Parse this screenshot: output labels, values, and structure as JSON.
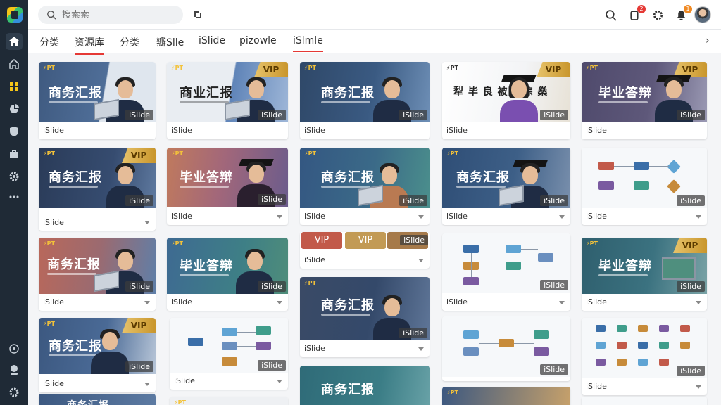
{
  "search": {
    "placeholder": "搜索索"
  },
  "tabs": [
    {
      "label": "分类"
    },
    {
      "label": "资源库"
    },
    {
      "label": "分类"
    },
    {
      "label": "瓣Slle"
    },
    {
      "label": "iSlide"
    },
    {
      "label": "pizowle"
    },
    {
      "label": "iSlmle"
    }
  ],
  "tab_next": "›",
  "topbar": {
    "notification_count_1": "2",
    "notification_count_2": "1"
  },
  "cards": [
    {
      "title": "商务汇报",
      "ppt": "⚡PT",
      "vip": "",
      "watermark": "iSlide",
      "label": "iSlide"
    },
    {
      "title": "商业汇报",
      "ppt": "⚡PT",
      "vip": "VIP",
      "watermark": "iSlide",
      "label": "iSlide"
    },
    {
      "title": "商务汇报",
      "ppt": "⚡PT",
      "vip": "",
      "watermark": "iSlide",
      "label": "iSlide"
    },
    {
      "title": "犁 毕 良 被阴 棕 燊",
      "ppt": "⚡PT",
      "vip": "VIP",
      "watermark": "iSlide",
      "label": "iSlide"
    },
    {
      "title": "毕业答辩",
      "ppt": "⚡PT",
      "vip": "VIP",
      "watermark": "iSlide",
      "label": "iSlide"
    },
    {
      "title": "商务汇报",
      "ppt": "⚡PT",
      "vip": "VIP",
      "watermark": "iSlide",
      "label": "iSlide"
    },
    {
      "title": "毕业答辩",
      "ppt": "⚡PT",
      "vip": "",
      "watermark": "iSlide",
      "label": "iSlide"
    },
    {
      "title": "商务汇报",
      "ppt": "⚡PT",
      "vip": "",
      "watermark": "iSlide",
      "label": "iSlide"
    },
    {
      "title": "商务汇报",
      "ppt": "⚡PT",
      "vip": "",
      "watermark": "iSlide",
      "label": "iSlide"
    },
    {
      "title": "",
      "ppt": "",
      "vip": "",
      "watermark": "iSlide",
      "label": "iSlide"
    },
    {
      "title": "商务汇报",
      "ppt": "⚡PT",
      "vip": "",
      "watermark": "iSlide",
      "label": "iSlide"
    },
    {
      "title": "毕业答辩",
      "ppt": "⚡PT",
      "vip": "",
      "watermark": "iSlide",
      "label": "iSlide"
    },
    {
      "title": "",
      "ppt": "",
      "vip": "VIP",
      "watermark": "iSlide",
      "label": "iSlide"
    },
    {
      "title": "",
      "ppt": "",
      "vip": "",
      "watermark": "iSlide",
      "label": "iSlide"
    },
    {
      "title": "毕业答辩",
      "ppt": "⚡PT",
      "vip": "VIP",
      "watermark": "iSlide",
      "label": "iSlide"
    },
    {
      "title": "商务汇报",
      "ppt": "⚡PT",
      "vip": "VIP",
      "watermark": "iSlide",
      "label": "iSlide"
    },
    {
      "title": "",
      "ppt": "",
      "vip": "",
      "watermark": "iSlide",
      "label": "iSlide"
    },
    {
      "title": "商务汇报",
      "ppt": "⚡PT",
      "vip": "",
      "watermark": "iSlide",
      "label": "iSlide"
    },
    {
      "title": "",
      "ppt": "",
      "vip": "",
      "watermark": "iSlide",
      "label": "iSlide"
    },
    {
      "title": "",
      "ppt": "",
      "vip": "",
      "watermark": "iSlide",
      "label": "iSlide"
    },
    {
      "title": "商务汇报",
      "ppt": "",
      "vip": "",
      "watermark": "",
      "label": ""
    },
    {
      "title": "",
      "ppt": "⚡PT",
      "vip": "",
      "watermark": "",
      "label": ""
    },
    {
      "title": "",
      "ppt": "⚡PT",
      "vip": "",
      "watermark": "",
      "label": ""
    }
  ],
  "vip_chips": [
    "VIP",
    "VIP"
  ],
  "colors": {
    "accent": "#e53935",
    "sidebar": "#1f2a36",
    "vip_gold": "#d9a94a"
  }
}
